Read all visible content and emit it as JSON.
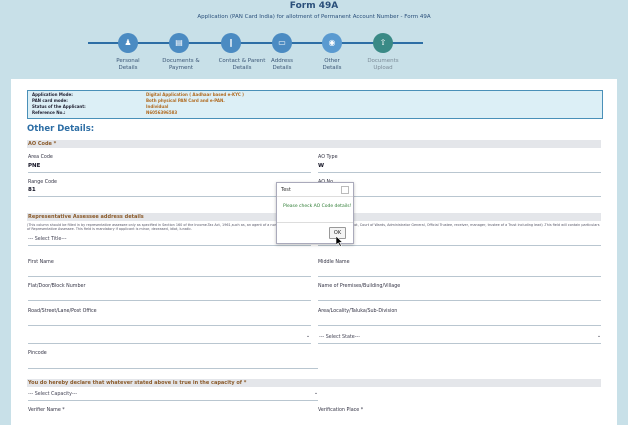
{
  "header": {
    "title": "Form 49A",
    "subtitle": "Application (PAN Card India) for allotment of Permanent Account Number - Form 49A"
  },
  "steps": [
    {
      "label1": "Personal",
      "label2": "Details",
      "icon": "person-icon",
      "glyph": "♟"
    },
    {
      "label1": "Documents &",
      "label2": "Payment",
      "icon": "document-icon",
      "glyph": "▤"
    },
    {
      "label1": "Contact & Parent",
      "label2": "Details",
      "icon": "contact-icon",
      "glyph": "∥"
    },
    {
      "label1": "Address",
      "label2": "Details",
      "icon": "address-card-icon",
      "glyph": "▭"
    },
    {
      "label1": "Other",
      "label2": "Details",
      "icon": "other-details-icon",
      "glyph": "◉"
    },
    {
      "label1": "Documents",
      "label2": "Upload",
      "icon": "upload-icon",
      "glyph": "⇧"
    }
  ],
  "info": {
    "rows": [
      {
        "label": "Application Mode:",
        "value": "Digital Application ( Aadhaar based e-KYC )"
      },
      {
        "label": "PAN card mode:",
        "value": "Both physical PAN Card and e-PAN."
      },
      {
        "label": "Status of the Applicant:",
        "value": "Individual"
      },
      {
        "label": "Reference No.:",
        "value": "N6056396583"
      }
    ]
  },
  "section_title": "Other Details:",
  "ao": {
    "band": "AO Code *",
    "area_code_label": "Area Code",
    "area_code_value": "PNE",
    "ao_type_label": "AO Type",
    "ao_type_value": "W",
    "range_code_label": "Range Code",
    "range_code_value": "81",
    "ao_no_label": "AO No."
  },
  "rep": {
    "band": "Representative Assessee address details",
    "note": "(This column should be filled in by representative assessee only as specified in Section 160 of the Income-Tax Act, 1961,such as, an agent of a non-resident or guardian of a minor, lunatic or idiot, Court of Wards, Administrator General, Official Trustee, receiver, manager, trustee of a Trust including lead) -This field will contain particulars of Representative Assessee. This field is mandatory if applicant is minor, deceased, idiot, lunatic.",
    "title_select": "--- Select Title---",
    "last_name_label": "Last Name",
    "first_name_label": "First Name",
    "middle_name_label": "Middle Name",
    "flat_label": "Flat/Door/Block Number",
    "premises_label": "Name of Premises/Building/Village",
    "road_label": "Road/Street/Lane/Post Office",
    "area_label": "Area/Locality/Taluka/Sub-Division",
    "state_select": "--- Select State---",
    "pincode_label": "Pincode"
  },
  "declare": {
    "band": "You do hereby declare that whatever stated above is true in the capacity of *",
    "capacity_select": "--- Select Capacity---",
    "verifier_label": "Verifier Name *",
    "place_label": "Verification Place *"
  },
  "modal": {
    "title": "Test",
    "message": "Please check AO Code details!",
    "ok": "OK"
  }
}
